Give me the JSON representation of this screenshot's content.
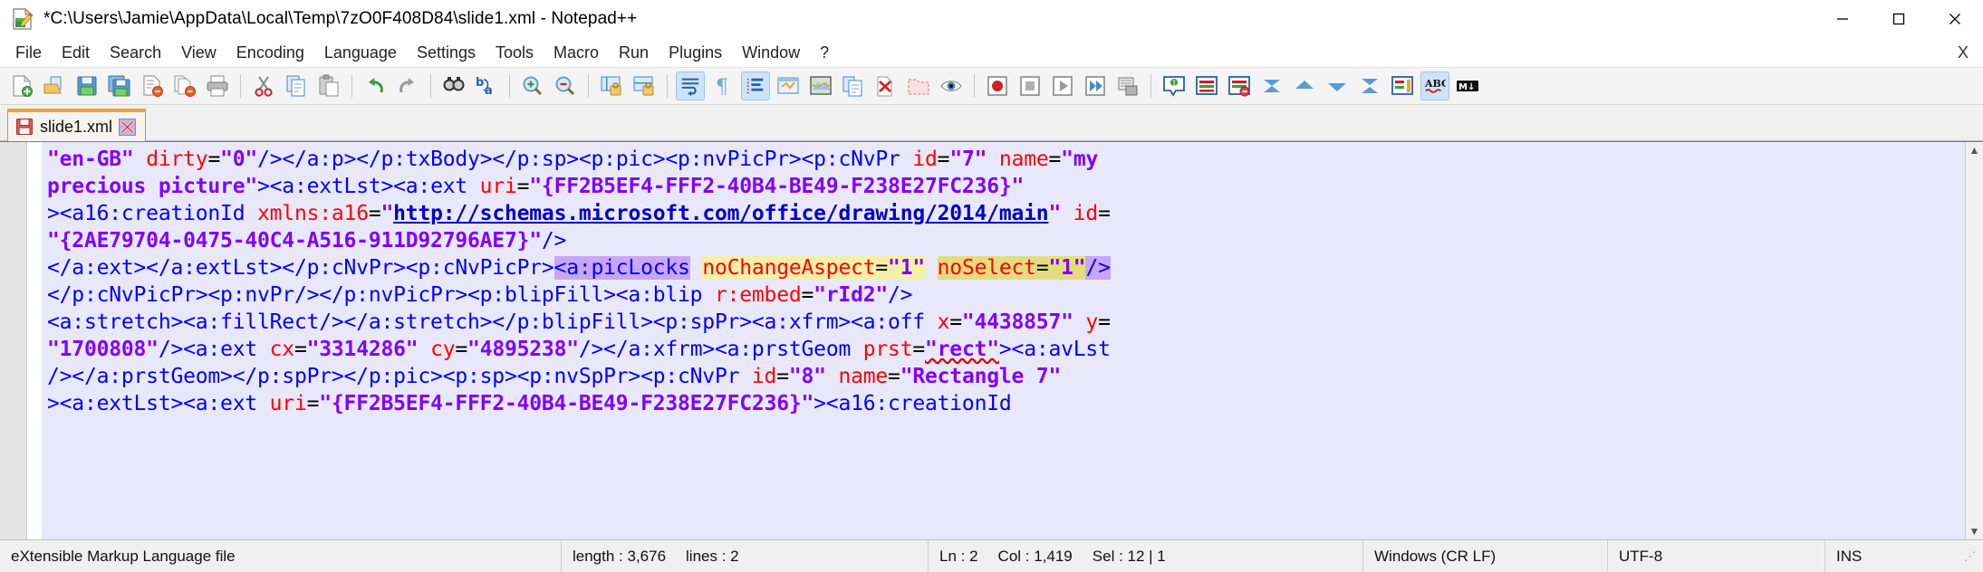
{
  "titlebar": {
    "title": "*C:\\Users\\Jamie\\AppData\\Local\\Temp\\7zO0F408D84\\slide1.xml - Notepad++",
    "icon": "notepad-plus-plus-document-icon",
    "minimize_label": "—",
    "maximize_label": "☐",
    "close_label": "✕"
  },
  "menubar": {
    "items": [
      {
        "label": "File"
      },
      {
        "label": "Edit"
      },
      {
        "label": "Search"
      },
      {
        "label": "View"
      },
      {
        "label": "Encoding"
      },
      {
        "label": "Language"
      },
      {
        "label": "Settings"
      },
      {
        "label": "Tools"
      },
      {
        "label": "Macro"
      },
      {
        "label": "Run"
      },
      {
        "label": "Plugins"
      },
      {
        "label": "Window"
      },
      {
        "label": "?"
      }
    ],
    "close_document_label": "X"
  },
  "toolbar": {
    "buttons": [
      {
        "name": "new-file-icon",
        "title": "New"
      },
      {
        "name": "open-file-icon",
        "title": "Open"
      },
      {
        "name": "save-icon",
        "title": "Save"
      },
      {
        "name": "save-all-icon",
        "title": "Save All"
      },
      {
        "name": "close-file-icon",
        "title": "Close"
      },
      {
        "name": "close-all-icon",
        "title": "Close All"
      },
      {
        "name": "print-icon",
        "title": "Print"
      },
      {
        "name": "cut-icon",
        "title": "Cut"
      },
      {
        "name": "copy-icon",
        "title": "Copy"
      },
      {
        "name": "paste-icon",
        "title": "Paste"
      },
      {
        "name": "undo-icon",
        "title": "Undo"
      },
      {
        "name": "redo-icon",
        "title": "Redo"
      },
      {
        "name": "find-icon",
        "title": "Find"
      },
      {
        "name": "replace-icon",
        "title": "Replace"
      },
      {
        "name": "zoom-in-icon",
        "title": "Zoom In"
      },
      {
        "name": "zoom-out-icon",
        "title": "Zoom Out"
      },
      {
        "name": "sync-vertical-scroll-icon",
        "title": "Synchronize Vertical Scrolling"
      },
      {
        "name": "sync-horizontal-scroll-icon",
        "title": "Synchronize Horizontal Scrolling"
      },
      {
        "name": "word-wrap-icon",
        "title": "Word wrap"
      },
      {
        "name": "all-chars-icon",
        "title": "Show All Characters"
      },
      {
        "name": "indent-guide-icon",
        "title": "Show Indent Guide"
      },
      {
        "name": "udl-dialog-icon",
        "title": "User-Defined Language"
      },
      {
        "name": "document-map-icon",
        "title": "Document Map"
      },
      {
        "name": "function-list-icon",
        "title": "Function List"
      },
      {
        "name": "folder-workspace-icon",
        "title": "Folder as Workspace"
      },
      {
        "name": "monitoring-icon",
        "title": "Monitoring"
      },
      {
        "name": "record-macro-icon",
        "title": "Start Recording"
      },
      {
        "name": "stop-macro-icon",
        "title": "Stop Recording"
      },
      {
        "name": "play-macro-icon",
        "title": "Playback"
      },
      {
        "name": "run-multiple-icon",
        "title": "Run a Macro Multiple Times"
      },
      {
        "name": "save-macro-icon",
        "title": "Save Current Recorded Macro"
      },
      {
        "name": "show-bookmark-icon",
        "title": "Show Bookmark"
      },
      {
        "name": "compare-icon",
        "title": "Compare"
      },
      {
        "name": "clear-compare-icon",
        "title": "Clear Compare"
      },
      {
        "name": "first-diff-icon",
        "title": "First Difference"
      },
      {
        "name": "previous-diff-icon",
        "title": "Previous Difference"
      },
      {
        "name": "next-diff-icon",
        "title": "Next Difference"
      },
      {
        "name": "last-diff-icon",
        "title": "Last Difference"
      },
      {
        "name": "compare-navbar-icon",
        "title": "Navigation Bar"
      },
      {
        "name": "spell-check-icon",
        "title": "Spell Check"
      },
      {
        "name": "mime-tools-icon",
        "title": "MIME Tools"
      }
    ],
    "active_indices": [
      18,
      20,
      39
    ]
  },
  "tabs": [
    {
      "label": "slide1.xml",
      "icon": "unsaved-floppy-icon",
      "close_icon": "close-tab-icon",
      "modified": true
    }
  ],
  "editor": {
    "lines": [
      [
        {
          "text": "\"en-GB\"",
          "type": "val"
        },
        {
          "text": " ",
          "type": "plain"
        },
        {
          "text": "dirty",
          "type": "attr"
        },
        {
          "text": "=",
          "type": "plain"
        },
        {
          "text": "\"0\"",
          "type": "val"
        },
        {
          "text": "/></a:p></p:txBody></p:sp><p:pic><p:nvPicPr><p:cNvPr ",
          "type": "tag"
        },
        {
          "text": "id",
          "type": "attr"
        },
        {
          "text": "=",
          "type": "plain"
        },
        {
          "text": "\"7\"",
          "type": "val"
        },
        {
          "text": " ",
          "type": "plain"
        },
        {
          "text": "name",
          "type": "attr"
        },
        {
          "text": "=",
          "type": "plain"
        },
        {
          "text": "\"my",
          "type": "val"
        }
      ],
      [
        {
          "text": "precious picture\"",
          "type": "val"
        },
        {
          "text": "><a:extLst><a:ext ",
          "type": "tag"
        },
        {
          "text": "uri",
          "type": "attr"
        },
        {
          "text": "=",
          "type": "plain"
        },
        {
          "text": "\"{FF2B5EF4-FFF2-40B4-BE49-F238E27FC236}\"",
          "type": "val"
        }
      ],
      [
        {
          "text": "><a16:creationId ",
          "type": "tag"
        },
        {
          "text": "xmlns:a16",
          "type": "attr"
        },
        {
          "text": "=",
          "type": "plain"
        },
        {
          "text": "\"",
          "type": "val"
        },
        {
          "text": "http://schemas.microsoft.com/office/drawing/2014/main",
          "type": "url"
        },
        {
          "text": "\"",
          "type": "val"
        },
        {
          "text": " ",
          "type": "plain"
        },
        {
          "text": "id",
          "type": "attr"
        },
        {
          "text": "=",
          "type": "plain"
        }
      ],
      [
        {
          "text": "\"{2AE79704-0475-40C4-A516-911D92796AE7}\"",
          "type": "val"
        },
        {
          "text": "/>",
          "type": "tag"
        }
      ],
      [
        {
          "text": "</a:ext></a:extLst></p:cNvPr><p:cNvPicPr>",
          "type": "tag"
        },
        {
          "text": "<a:picLocks",
          "type": "tag",
          "mark": "sel"
        },
        {
          "text": " ",
          "type": "plain"
        },
        {
          "text": "noChangeAspect",
          "type": "attr",
          "mark": "hl"
        },
        {
          "text": "=",
          "type": "plain",
          "mark": "hl"
        },
        {
          "text": "\"1\"",
          "type": "val",
          "mark": "hl"
        },
        {
          "text": " ",
          "type": "plain"
        },
        {
          "text": "noSelect",
          "type": "attr",
          "mark": "hl-active"
        },
        {
          "text": "=",
          "type": "plain",
          "mark": "hl-active"
        },
        {
          "text": "\"1\"",
          "type": "val",
          "mark": "hl-active"
        },
        {
          "text": "/>",
          "type": "tag",
          "mark": "sel"
        }
      ],
      [
        {
          "text": "</p:cNvPicPr><p:nvPr/></p:nvPicPr><p:blipFill><a:blip ",
          "type": "tag"
        },
        {
          "text": "r:embed",
          "type": "attr"
        },
        {
          "text": "=",
          "type": "plain"
        },
        {
          "text": "\"rId2\"",
          "type": "val"
        },
        {
          "text": "/>",
          "type": "tag"
        }
      ],
      [
        {
          "text": "<a:stretch><a:fillRect/></a:stretch></p:blipFill><p:spPr><a:xfrm><a:off ",
          "type": "tag"
        },
        {
          "text": "x",
          "type": "attr"
        },
        {
          "text": "=",
          "type": "plain"
        },
        {
          "text": "\"4438857\"",
          "type": "val"
        },
        {
          "text": " ",
          "type": "plain"
        },
        {
          "text": "y",
          "type": "attr"
        },
        {
          "text": "=",
          "type": "plain"
        }
      ],
      [
        {
          "text": "\"1700808\"",
          "type": "val"
        },
        {
          "text": "/><a:ext ",
          "type": "tag"
        },
        {
          "text": "cx",
          "type": "attr"
        },
        {
          "text": "=",
          "type": "plain"
        },
        {
          "text": "\"3314286\"",
          "type": "val"
        },
        {
          "text": " ",
          "type": "plain"
        },
        {
          "text": "cy",
          "type": "attr"
        },
        {
          "text": "=",
          "type": "plain"
        },
        {
          "text": "\"4895238\"",
          "type": "val"
        },
        {
          "text": "/></a:xfrm><a:prstGeom ",
          "type": "tag"
        },
        {
          "text": "prst",
          "type": "attr"
        },
        {
          "text": "=",
          "type": "plain"
        },
        {
          "text": "\"rect\"",
          "type": "val",
          "squiggle": true
        },
        {
          "text": "><a:avLst",
          "type": "tag"
        }
      ],
      [
        {
          "text": "/></a:prstGeom></p:spPr></p:pic><p:sp><p:nvSpPr><p:cNvPr ",
          "type": "tag"
        },
        {
          "text": "id",
          "type": "attr"
        },
        {
          "text": "=",
          "type": "plain"
        },
        {
          "text": "\"8\"",
          "type": "val"
        },
        {
          "text": " ",
          "type": "plain"
        },
        {
          "text": "name",
          "type": "attr"
        },
        {
          "text": "=",
          "type": "plain"
        },
        {
          "text": "\"Rectangle 7\"",
          "type": "val"
        }
      ],
      [
        {
          "text": "><a:extLst><a:ext ",
          "type": "tag"
        },
        {
          "text": "uri",
          "type": "attr"
        },
        {
          "text": "=",
          "type": "plain"
        },
        {
          "text": "\"{FF2B5EF4-FFF2-40B4-BE49-F238E27FC236}\"",
          "type": "val"
        },
        {
          "text": "><a16:creationId",
          "type": "tag"
        }
      ]
    ],
    "scroll_up_label": "▲",
    "scroll_down_label": "▼"
  },
  "statusbar": {
    "file_type": "eXtensible Markup Language file",
    "length_label": "length : 3,676",
    "lines_label": "lines : 2",
    "ln": "Ln : 2",
    "col": "Col : 1,419",
    "sel": "Sel : 12 | 1",
    "eol": "Windows (CR LF)",
    "encoding": "UTF-8",
    "insert_mode": "INS"
  },
  "colors": {
    "tab_accent": "#f0a030",
    "selection": "#c9a6f5",
    "smart_highlight": "#f5f0a8",
    "smart_highlight_active": "#e3dd80",
    "editor_bg": "#e8e8fa",
    "tag": "#0000ff",
    "attr": "#ff0000",
    "value": "#8000ff"
  }
}
